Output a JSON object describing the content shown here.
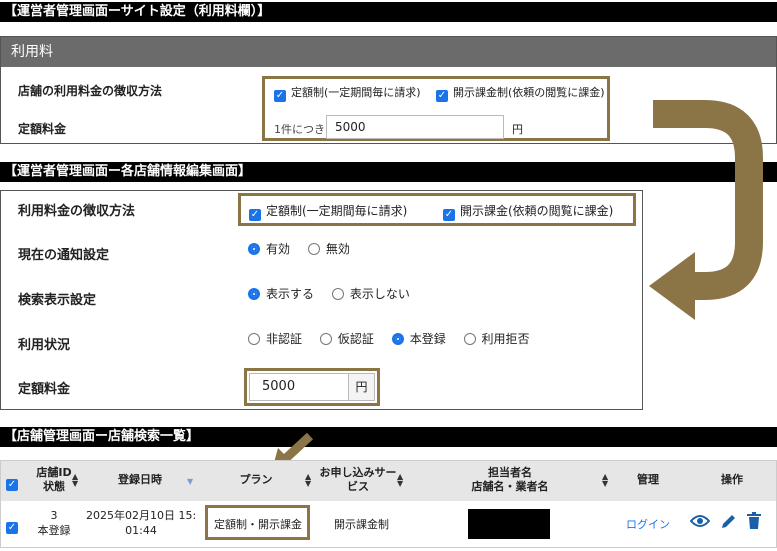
{
  "section1": {
    "title": "【運営者管理画面ーサイト設定（利用料欄）】",
    "panel_header": "利用料",
    "collection_label": "店舗の利用料金の徴収方法",
    "flat_label": "定額料金",
    "options": [
      {
        "label": "定額制(一定期間毎に請求)",
        "checked": true
      },
      {
        "label": "開示課金制(依頼の閲覧に課金)",
        "checked": true
      }
    ],
    "price_prefix": "1件につき",
    "price_value": "5000",
    "price_unit": "円"
  },
  "section2": {
    "title": "【運営者管理画面ー各店舗情報編集画面】",
    "collection_label": "利用料金の徴収方法",
    "options": [
      {
        "label": "定額制(一定期間毎に請求)",
        "checked": true
      },
      {
        "label": "開示課金(依頼の閲覧に課金)",
        "checked": true
      }
    ],
    "notify_label": "現在の通知設定",
    "notify_options": [
      "有効",
      "無効"
    ],
    "search_label": "検索表示設定",
    "search_options": [
      "表示する",
      "表示しない"
    ],
    "status_label": "利用状況",
    "status_options": [
      "非認証",
      "仮認証",
      "本登録",
      "利用拒否"
    ],
    "flat_label": "定額料金",
    "price_value": "5000",
    "price_unit": "円"
  },
  "section3": {
    "title": "【店舗管理画面ー店舗検索一覧】",
    "headers": {
      "id_line1": "店舗ID",
      "id_line2": "状態",
      "date": "登録日時",
      "plan": "プラン",
      "service_line1": "お申し込みサー",
      "service_line2": "ビス",
      "person_line1": "担当者名",
      "person_line2": "店舗名・業者名",
      "manage": "管理",
      "ops": "操作"
    },
    "row": {
      "id": "3",
      "status": "本登録",
      "date_line1": "2025年02月10日 15:",
      "date_line2": "01:44",
      "plan": "定額制・開示課金",
      "service": "開示課金制",
      "login": "ログイン"
    }
  },
  "colors": {
    "accent": "#8b7547",
    "panel_header": "#6b6b6b",
    "checkbox": "#1a73e8",
    "link": "#1a73e8"
  },
  "icons": [
    "checkbox-icon",
    "sort-icon",
    "eye-icon",
    "pencil-icon",
    "trash-icon",
    "arrow-icon"
  ]
}
